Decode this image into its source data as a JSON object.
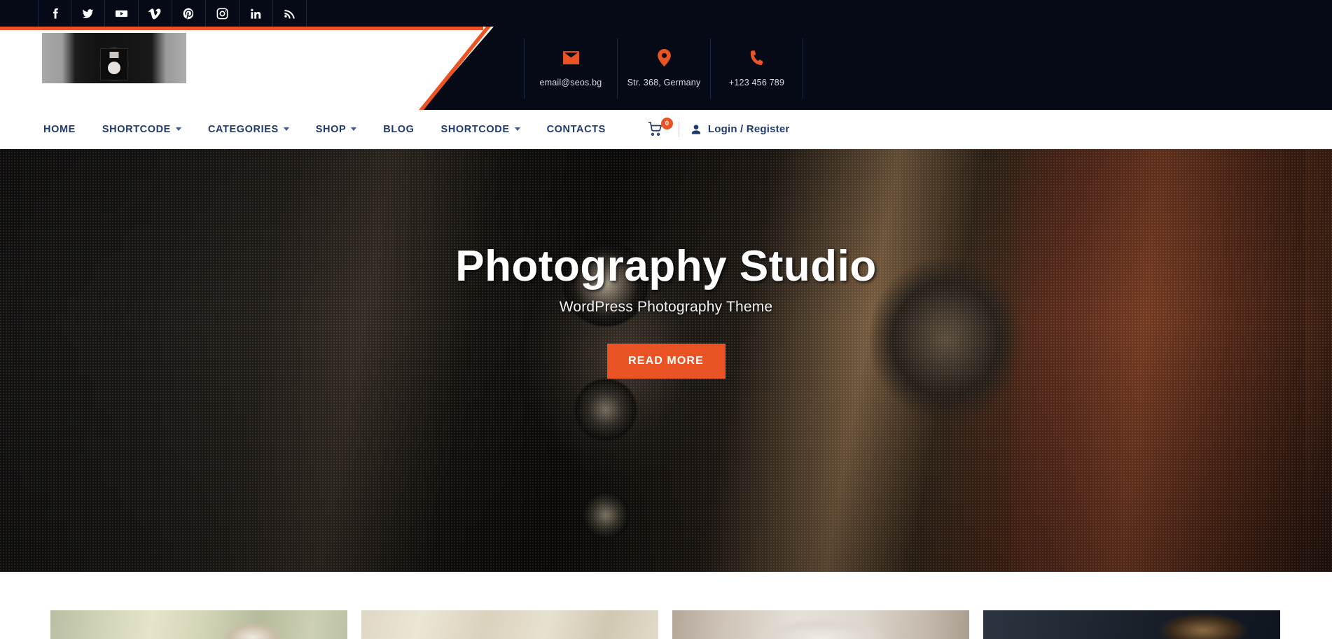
{
  "social_bar": {
    "icons": [
      {
        "name": "facebook-icon",
        "label": "Facebook"
      },
      {
        "name": "twitter-icon",
        "label": "Twitter"
      },
      {
        "name": "youtube-icon",
        "label": "YouTube"
      },
      {
        "name": "vimeo-icon",
        "label": "Vimeo"
      },
      {
        "name": "pinterest-icon",
        "label": "Pinterest"
      },
      {
        "name": "instagram-icon",
        "label": "Instagram"
      },
      {
        "name": "linkedin-icon",
        "label": "LinkedIn"
      },
      {
        "name": "rss-icon",
        "label": "RSS"
      }
    ]
  },
  "header": {
    "logo_alt": "Photography studio logo",
    "contacts": [
      {
        "icon": "envelope-icon",
        "text": "email@seos.bg"
      },
      {
        "icon": "map-pin-icon",
        "text": "Str. 368, Germany"
      },
      {
        "icon": "phone-icon",
        "text": "+123 456 789"
      }
    ]
  },
  "nav": {
    "items": [
      {
        "label": "HOME",
        "has_dropdown": false
      },
      {
        "label": "SHORTCODE",
        "has_dropdown": true
      },
      {
        "label": "CATEGORIES",
        "has_dropdown": true
      },
      {
        "label": "SHOP",
        "has_dropdown": true
      },
      {
        "label": "BLOG",
        "has_dropdown": false
      },
      {
        "label": "SHORTCODE",
        "has_dropdown": true
      },
      {
        "label": "CONTACTS",
        "has_dropdown": false
      }
    ],
    "cart_count": "0",
    "login_label": "Login / Register"
  },
  "hero": {
    "title": "Photography Studio",
    "subtitle": "WordPress Photography Theme",
    "button_label": "READ MORE"
  },
  "gallery": {
    "thumbs": [
      {
        "name": "gallery-thumb-1",
        "alt": "Bird in tall grass"
      },
      {
        "name": "gallery-thumb-2",
        "alt": "Winter branches sepia"
      },
      {
        "name": "gallery-thumb-3",
        "alt": "Ceramic vessel closeup"
      },
      {
        "name": "gallery-thumb-4",
        "alt": "Hair against dark background"
      }
    ]
  },
  "colors": {
    "accent_orange": "#EA5425",
    "dark_navy": "#050A16",
    "nav_blue": "#1F3A6E",
    "white": "#FFFFFF"
  }
}
